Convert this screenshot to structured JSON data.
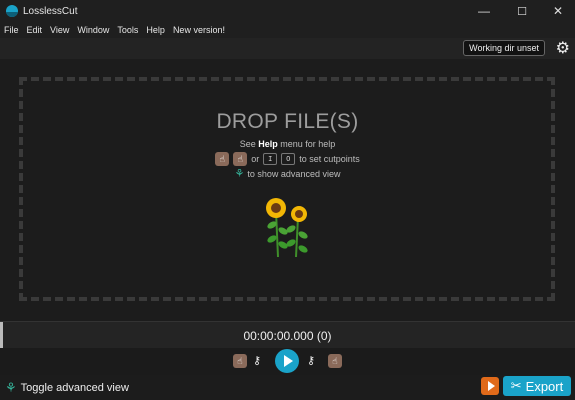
{
  "window": {
    "title": "LosslessCut",
    "controls": {
      "minimize": "—",
      "maximize": "☐",
      "close": "✕"
    }
  },
  "menu": [
    "File",
    "Edit",
    "View",
    "Window",
    "Tools",
    "Help",
    "New version!"
  ],
  "topbar": {
    "working_dir_label": "Working dir unset",
    "settings_icon": "gear-icon"
  },
  "dropzone": {
    "title": "DROP FILE(S)",
    "help_prefix": "See ",
    "help_bold": "Help",
    "help_suffix": " menu for help",
    "cutpoint_or": "or",
    "cutpoint_key_start": "I",
    "cutpoint_key_end": "O",
    "cutpoint_text": "to set cutpoints",
    "advanced_text": "to show advanced view",
    "illustration": "sunflowers"
  },
  "timeline": {
    "timecode": "00:00:00.000 (0)"
  },
  "bottom": {
    "toggle_advanced_label": "Toggle advanced view",
    "export_label": "Export"
  },
  "colors": {
    "accent": "#1aa3c9",
    "export_orange": "#e06a1a",
    "background": "#1c1c1c"
  }
}
